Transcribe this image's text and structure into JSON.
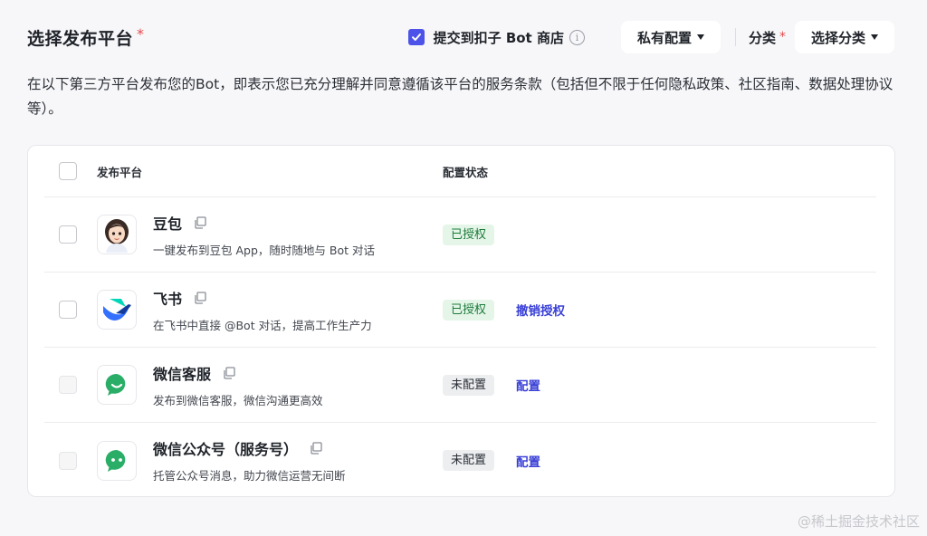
{
  "header": {
    "title": "选择发布平台",
    "required_mark": "*",
    "submit_store_label": "提交到扣子 Bot 商店",
    "submit_store_checked": true,
    "info_glyph": "i",
    "private_config_label": "私有配置",
    "category_label": "分类",
    "category_required_mark": "*",
    "category_select_label": "选择分类"
  },
  "description": "在以下第三方平台发布您的Bot，即表示您已充分理解并同意遵循该平台的服务条款（包括但不限于任何隐私政策、社区指南、数据处理协议等）。",
  "table": {
    "columns": {
      "platform": "发布平台",
      "status": "配置状态"
    },
    "rows": [
      {
        "name": "豆包",
        "desc": "一键发布到豆包 App，随时随地与 Bot 对话",
        "status": "已授权",
        "status_type": "authorized",
        "action": "",
        "icon": "doubao-avatar-icon",
        "enabled": true
      },
      {
        "name": "飞书",
        "desc": "在飞书中直接 @Bot 对话，提高工作生产力",
        "status": "已授权",
        "status_type": "authorized",
        "action": "撤销授权",
        "icon": "feishu-icon",
        "enabled": true
      },
      {
        "name": "微信客服",
        "desc": "发布到微信客服，微信沟通更高效",
        "status": "未配置",
        "status_type": "unconfigured",
        "action": "配置",
        "icon": "wechat-kefu-icon",
        "enabled": false
      },
      {
        "name": "微信公众号（服务号）",
        "desc": "托管公众号消息，助力微信运营无间断",
        "status": "未配置",
        "status_type": "unconfigured",
        "action": "配置",
        "icon": "wechat-official-icon",
        "enabled": false
      }
    ]
  },
  "watermark": "@稀土掘金技术社区",
  "colors": {
    "accent": "#4d53e8",
    "link": "#3a40d6",
    "authorized_bg": "#e5f6e9",
    "authorized_text": "#1c7a3a",
    "wechat_green": "#2aae67"
  }
}
